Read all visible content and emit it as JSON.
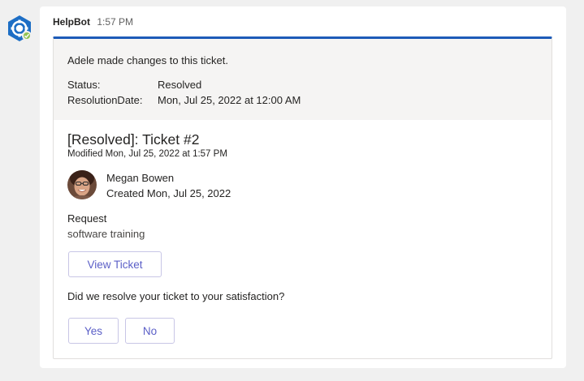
{
  "bot": {
    "name": "HelpBot",
    "time": "1:57 PM",
    "presence": "available"
  },
  "change": {
    "summary": "Adele made changes to this ticket.",
    "facts": [
      {
        "key": "Status:",
        "value": "Resolved"
      },
      {
        "key": "ResolutionDate:",
        "value": "Mon, Jul 25, 2022 at 12:00 AM"
      }
    ]
  },
  "ticket": {
    "title": "[Resolved]: Ticket #2",
    "modified": "Modified Mon, Jul 25, 2022 at 1:57 PM",
    "requester_name": "Megan Bowen",
    "created": "Created Mon, Jul 25, 2022",
    "request_label": "Request",
    "request_value": "software training",
    "view_button": "View Ticket"
  },
  "feedback": {
    "question": "Did we resolve your ticket to your satisfaction?",
    "yes_label": "Yes",
    "no_label": "No"
  },
  "colors": {
    "accent_bar": "#1d5bb8",
    "button_text": "#5b5fc7",
    "presence": "#92c353"
  }
}
